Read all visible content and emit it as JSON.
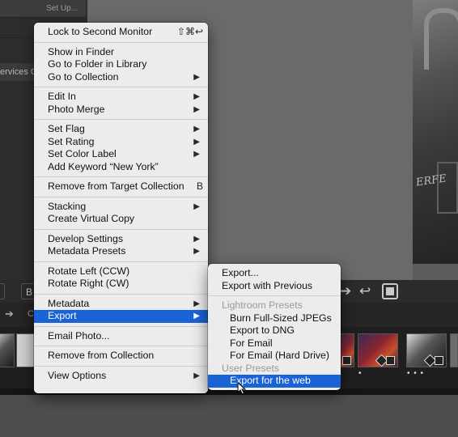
{
  "background": {
    "left_panel": {
      "setup_label": "Set Up...",
      "services_label": "ervices O"
    },
    "toolbar": {
      "button_partial": "B"
    },
    "filmstrip": {
      "nav_label": "C",
      "thumb_dots": "• • •",
      "thumb_dot": "•"
    },
    "photo_graffiti": "ERFE"
  },
  "context_menu": {
    "items": [
      {
        "label": "Lock to Second Monitor",
        "shortcut": "⇧⌘↩"
      },
      {
        "label": "Show in Finder"
      },
      {
        "label": "Go to Folder in Library"
      },
      {
        "label": "Go to Collection",
        "submenu": true
      },
      {
        "label": "Edit In",
        "submenu": true
      },
      {
        "label": "Photo Merge",
        "submenu": true
      },
      {
        "label": "Set Flag",
        "submenu": true
      },
      {
        "label": "Set Rating",
        "submenu": true
      },
      {
        "label": "Set Color Label",
        "submenu": true
      },
      {
        "label": "Add Keyword “New York”"
      },
      {
        "label": "Remove from Target Collection",
        "shortcut": "B"
      },
      {
        "label": "Stacking",
        "submenu": true
      },
      {
        "label": "Create Virtual Copy"
      },
      {
        "label": "Develop Settings",
        "submenu": true
      },
      {
        "label": "Metadata Presets",
        "submenu": true
      },
      {
        "label": "Rotate Left (CCW)"
      },
      {
        "label": "Rotate Right (CW)"
      },
      {
        "label": "Metadata",
        "submenu": true
      },
      {
        "label": "Export",
        "submenu": true,
        "selected": true
      },
      {
        "label": "Email Photo..."
      },
      {
        "label": "Remove from Collection"
      },
      {
        "label": "View Options",
        "submenu": true
      }
    ]
  },
  "export_submenu": {
    "items": [
      {
        "label": "Export..."
      },
      {
        "label": "Export with Previous"
      },
      {
        "label": "Lightroom Presets",
        "header": true
      },
      {
        "label": "Burn Full-Sized JPEGs"
      },
      {
        "label": "Export to DNG"
      },
      {
        "label": "For Email"
      },
      {
        "label": "For Email (Hard Drive)"
      },
      {
        "label": "User Presets",
        "header": true
      },
      {
        "label": "Export for the web",
        "selected": true
      }
    ]
  },
  "icons": {
    "submenu_chevron": "▶",
    "nav_arrow": "➔",
    "undo_arrow": "↩"
  },
  "colors": {
    "menu_bg": "#ececec",
    "selection": "#1a63d6",
    "header_text": "#9a9a9a"
  }
}
